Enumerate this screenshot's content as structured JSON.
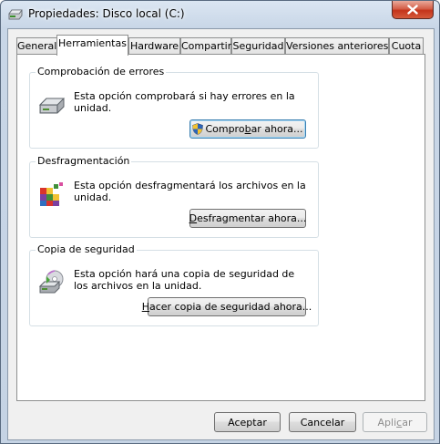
{
  "window": {
    "title": "Propiedades: Disco local (C:)"
  },
  "tabs": [
    {
      "label": "General"
    },
    {
      "label": "Herramientas",
      "active": true
    },
    {
      "label": "Hardware"
    },
    {
      "label": "Compartir"
    },
    {
      "label": "Seguridad"
    },
    {
      "label": "Versiones anteriores"
    },
    {
      "label": "Cuota"
    }
  ],
  "groups": {
    "error_check": {
      "title": "Comprobación de errores",
      "description": "Esta opción comprobará si hay errores en la unidad.",
      "button": {
        "pre": "Compro",
        "accel": "b",
        "post": "ar ahora...",
        "icon": "uac-shield-icon"
      },
      "icon": "hard-drive-icon"
    },
    "defrag": {
      "title": "Desfragmentación",
      "description": "Esta opción desfragmentará los archivos en la unidad.",
      "button": {
        "pre": "",
        "accel": "D",
        "post": "esfragmentar ahora..."
      },
      "icon": "defragment-icon"
    },
    "backup": {
      "title": "Copia de seguridad",
      "description": "Esta opción hará una copia de seguridad de los archivos en la unidad.",
      "button": {
        "pre": "",
        "accel": "H",
        "post": "acer copia de seguridad ahora..."
      },
      "icon": "backup-icon"
    }
  },
  "footer": {
    "accept": "Aceptar",
    "cancel": "Cancelar",
    "apply_pre": "Apli",
    "apply_accel": "c",
    "apply_post": "ar"
  }
}
